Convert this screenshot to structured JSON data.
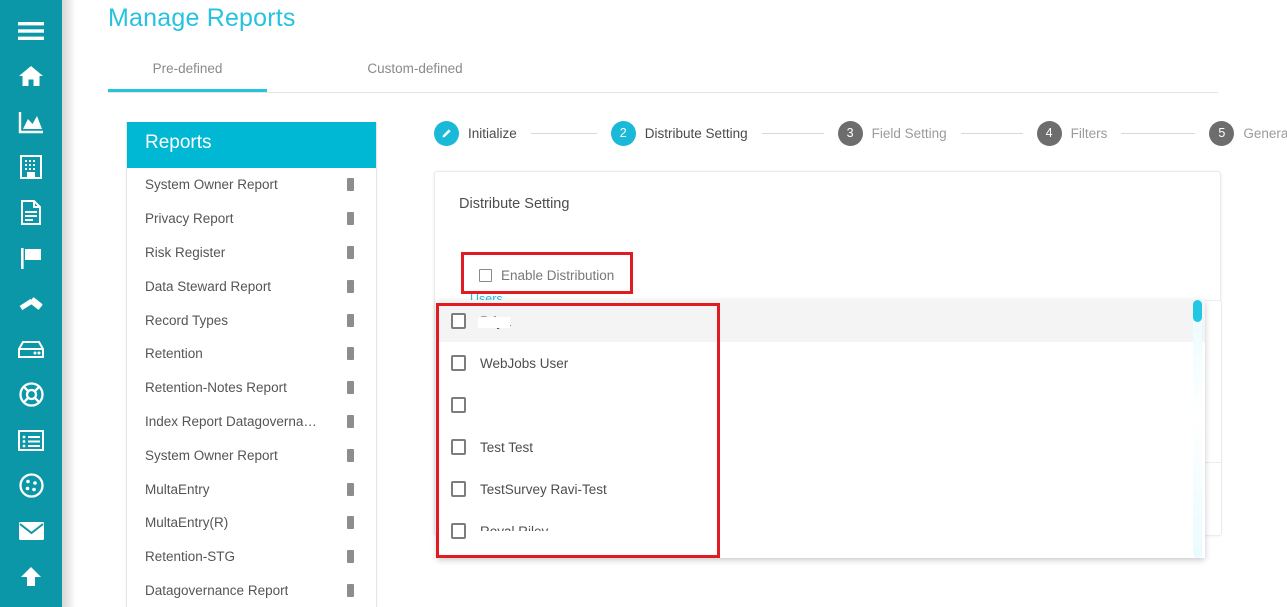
{
  "colors": {
    "rail": "#0c97a8",
    "accent": "#26c2e0",
    "reports_header": "#00b8d4",
    "step_active": "#1ab9d8",
    "step_todo": "#6d6d6d",
    "annotation": "#e01b22"
  },
  "rail": {
    "items": [
      {
        "name": "menu-icon",
        "label": "Menu"
      },
      {
        "name": "home-icon",
        "label": "Home"
      },
      {
        "name": "chart-area-icon",
        "label": "Analytics"
      },
      {
        "name": "building-icon",
        "label": "Organization"
      },
      {
        "name": "document-icon",
        "label": "Documents"
      },
      {
        "name": "flag-icon",
        "label": "Flags"
      },
      {
        "name": "gavel-icon",
        "label": "Legal"
      },
      {
        "name": "archive-icon",
        "label": "Archive"
      },
      {
        "name": "lifebuoy-icon",
        "label": "Support"
      },
      {
        "name": "list-card-icon",
        "label": "Records"
      },
      {
        "name": "cookie-icon",
        "label": "Cookies"
      },
      {
        "name": "envelope-icon",
        "label": "Mail"
      },
      {
        "name": "upload-icon",
        "label": "Upload"
      }
    ]
  },
  "header": {
    "title": "Manage Reports"
  },
  "tabs": [
    {
      "label": "Pre-defined",
      "active": true
    },
    {
      "label": "Custom-defined",
      "active": false
    }
  ],
  "reports_panel": {
    "title": "Reports",
    "delete_icon": "trash-icon",
    "items": [
      "System Owner Report",
      "Privacy Report",
      "Risk Register",
      "Data Steward Report",
      "Record Types",
      "Retention",
      "Retention-Notes Report",
      "Index Report Datagoverna…",
      "System Owner Report",
      "MultaEntry",
      "MultaEntry(R)",
      "Retention-STG",
      "Datagovernance Report"
    ]
  },
  "stepper": {
    "steps": [
      {
        "num": "1",
        "badge": "pencil-icon",
        "label": "Initialize",
        "state": "done"
      },
      {
        "num": "2",
        "badge": "2",
        "label": "Distribute Setting",
        "state": "active"
      },
      {
        "num": "3",
        "badge": "3",
        "label": "Field Setting",
        "state": "todo"
      },
      {
        "num": "4",
        "badge": "4",
        "label": "Filters",
        "state": "todo"
      },
      {
        "num": "5",
        "badge": "5",
        "label": "Generate",
        "state": "todo"
      }
    ]
  },
  "panel": {
    "title": "Distribute Setting",
    "enable_distribution": {
      "label": "Enable Distribution",
      "checked": false
    },
    "users_label": "Users"
  },
  "user_dropdown": {
    "items": [
      {
        "label": "Priya",
        "checked": false,
        "highlighted": true,
        "obscured": "redacted"
      },
      {
        "label": "WebJobs User",
        "checked": false,
        "highlighted": false,
        "obscured": ""
      },
      {
        "label": "",
        "checked": false,
        "highlighted": false,
        "obscured": ""
      },
      {
        "label": "Test Test",
        "checked": false,
        "highlighted": false,
        "obscured": ""
      },
      {
        "label": "TestSurvey Ravi-Test",
        "checked": false,
        "highlighted": false,
        "obscured": ""
      },
      {
        "label": "Royal Riley",
        "checked": false,
        "highlighted": false,
        "obscured": "clipped"
      }
    ]
  },
  "annotations": [
    {
      "name": "highlight-enable-distribution"
    },
    {
      "name": "highlight-users-list"
    }
  ]
}
